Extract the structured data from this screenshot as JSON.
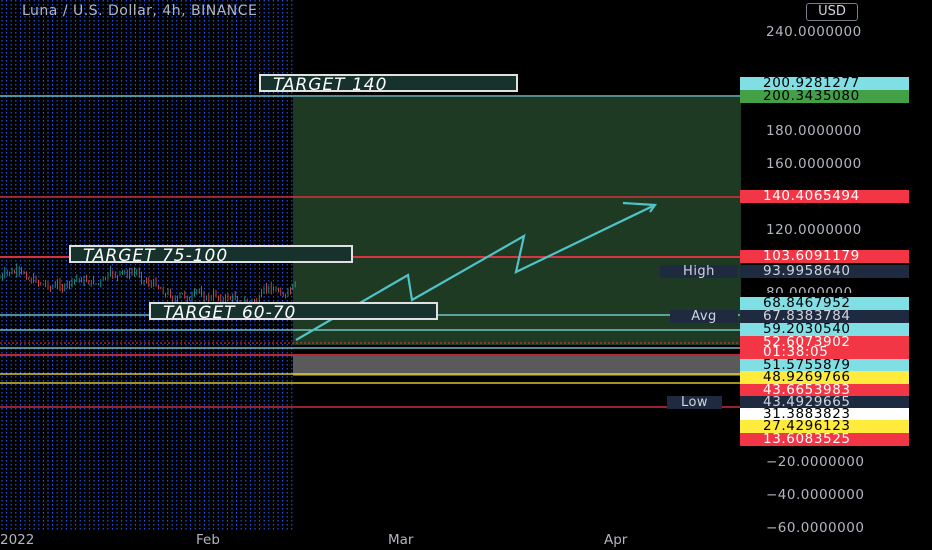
{
  "header": {
    "symbol_line": "Luna / U.S. Dollar, 4h, BINANCE",
    "currency_button": "USD"
  },
  "colors": {
    "background": "#000000",
    "grid_dotted": "#2962ff",
    "green_zone": "#1f3a22",
    "red_line": "#f23645",
    "teal_line": "#5fd3d8",
    "yellow_line": "#ffeb3b",
    "arrow": "#4fc3c7"
  },
  "annotations": {
    "target_140": "TARGET  140",
    "target_75_100": "TARGET  75-100",
    "target_60_70": "TARGET  60-70"
  },
  "price_axis": {
    "ticks": [
      "240.0000000",
      "180.0000000",
      "160.0000000",
      "120.0000000",
      "80.0000000",
      "−20.0000000",
      "−40.0000000",
      "−60.0000000"
    ]
  },
  "price_labels": [
    {
      "text": "200.9281277",
      "bg": "#7fdfe5",
      "fg": "#000000",
      "price": 200.9281277
    },
    {
      "text": "200.3435080",
      "bg": "#43a047",
      "fg": "#000000",
      "price": 200.343508
    },
    {
      "text": "140.4065494",
      "bg": "#f23645",
      "fg": "#ffffff",
      "price": 140.4065494
    },
    {
      "text": "103.6091179",
      "bg": "#f23645",
      "fg": "#ffffff",
      "price": 103.6091179
    },
    {
      "text": "93.9958640",
      "bg": "#1d2a3f",
      "fg": "#d1d4dc",
      "price": 93.995864
    },
    {
      "text": "68.8467952",
      "bg": "#7fdfe5",
      "fg": "#000000",
      "price": 68.8467952
    },
    {
      "text": "67.8383784",
      "bg": "#1d2a3f",
      "fg": "#d1d4dc",
      "price": 67.8383784
    },
    {
      "text": "59.2030540",
      "bg": "#7fdfe5",
      "fg": "#000000",
      "price": 59.203054
    },
    {
      "text": "52.6073902",
      "bg": "#f23645",
      "fg": "#ffffff",
      "price": 52.6073902
    },
    {
      "text": "01:38:05",
      "bg": "#f23645",
      "fg": "#ffffff",
      "price": null
    },
    {
      "text": "51.5755879",
      "bg": "#7fdfe5",
      "fg": "#000000",
      "price": 51.5755879
    },
    {
      "text": "48.9269766",
      "bg": "#ffeb3b",
      "fg": "#000000",
      "price": 48.9269766
    },
    {
      "text": "43.6653983",
      "bg": "#f23645",
      "fg": "#ffffff",
      "price": 43.6653983
    },
    {
      "text": "43.4929665",
      "bg": "#1d2a3f",
      "fg": "#d1d4dc",
      "price": 43.4929665
    },
    {
      "text": "31.3883823",
      "bg": "#ffffff",
      "fg": "#000000",
      "price": 31.3883823
    },
    {
      "text": "27.4296123",
      "bg": "#ffeb3b",
      "fg": "#000000",
      "price": 27.4296123
    },
    {
      "text": "13.6083525",
      "bg": "#f23645",
      "fg": "#ffffff",
      "price": 13.6083525
    }
  ],
  "tags": {
    "high": "High",
    "avg": "Avg",
    "low": "Low"
  },
  "time_axis": {
    "labels": [
      "2022",
      "Feb",
      "Mar",
      "Apr"
    ]
  }
}
